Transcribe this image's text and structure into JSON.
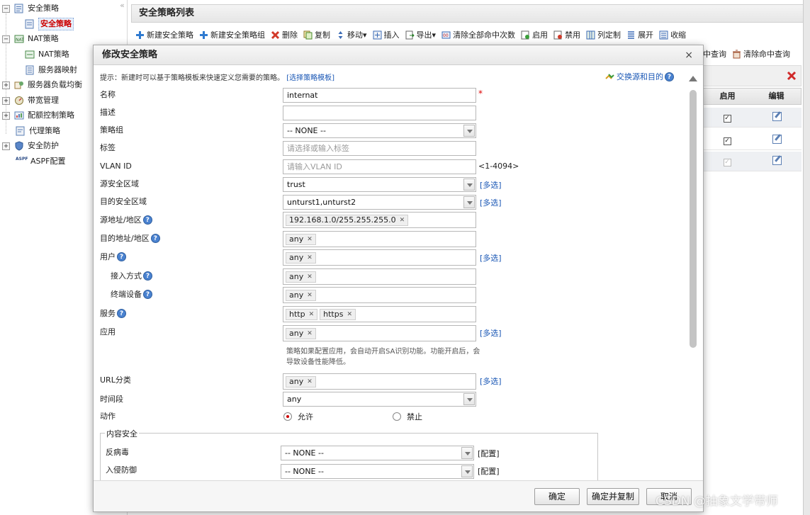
{
  "sidebar": {
    "collapse_glyph": "«",
    "items": [
      {
        "label": "安全策略",
        "toggle": "−",
        "icon": "policy-folder-icon"
      },
      {
        "label": "安全策略",
        "selected": true,
        "icon": "policy-icon"
      },
      {
        "label": "NAT策略",
        "toggle": "−",
        "icon": "nat-icon"
      },
      {
        "label": "NAT策略",
        "icon": "nat-policy-icon"
      },
      {
        "label": "服务器映射",
        "icon": "server-map-icon"
      },
      {
        "label": "服务器负载均衡",
        "toggle": "+",
        "icon": "load-balance-icon"
      },
      {
        "label": "带宽管理",
        "toggle": "+",
        "icon": "bandwidth-icon"
      },
      {
        "label": "配额控制策略",
        "toggle": "+",
        "icon": "quota-icon"
      },
      {
        "label": "代理策略",
        "icon": "proxy-icon"
      },
      {
        "label": "安全防护",
        "toggle": "+",
        "icon": "shield-icon"
      },
      {
        "label": "ASPF配置",
        "icon": "aspf-icon",
        "icon_text": "ASPF"
      }
    ]
  },
  "main": {
    "title": "安全策略列表",
    "toolbar": [
      {
        "label": "新建安全策略",
        "icon": "plus-icon"
      },
      {
        "label": "新建安全策略组",
        "icon": "plus-icon"
      },
      {
        "label": "删除",
        "icon": "delete-icon"
      },
      {
        "label": "复制",
        "icon": "copy-icon"
      },
      {
        "label": "移动▾",
        "icon": "move-icon"
      },
      {
        "label": "插入",
        "icon": "insert-icon"
      },
      {
        "label": "导出▾",
        "icon": "export-icon"
      },
      {
        "label": "清除全部命中次数",
        "icon": "clear-hits-icon"
      },
      {
        "label": "启用",
        "icon": "enable-icon"
      },
      {
        "label": "禁用",
        "icon": "disable-icon"
      },
      {
        "label": "列定制",
        "icon": "columns-icon"
      },
      {
        "label": "展开",
        "icon": "expand-icon"
      },
      {
        "label": "收缩",
        "icon": "collapse-icon"
      }
    ],
    "toolbar2": [
      {
        "label": "中查询"
      },
      {
        "label": "清除命中查询",
        "icon": "clear-query-icon"
      }
    ],
    "table": {
      "headers": [
        "启用",
        "编辑"
      ],
      "rows": [
        {
          "enabled": true,
          "disabled": false
        },
        {
          "enabled": true,
          "disabled": false
        },
        {
          "enabled": true,
          "disabled": true
        }
      ]
    }
  },
  "dialog": {
    "title": "修改安全策略",
    "close": "×",
    "hint_text": "提示：新建时可以基于策略模板来快速定义您需要的策略。",
    "hint_link": "[选择策略模板]",
    "swap_label": "交换源和目的",
    "fields": {
      "name": {
        "label": "名称",
        "value": "internat",
        "required": "*"
      },
      "desc": {
        "label": "描述",
        "value": ""
      },
      "group": {
        "label": "策略组",
        "value": "-- NONE --"
      },
      "tag": {
        "label": "标签",
        "placeholder": "请选择或输入标签"
      },
      "vlan": {
        "label": "VLAN ID",
        "placeholder": "请输入VLAN ID",
        "range": "<1-4094>"
      },
      "src_zone": {
        "label": "源安全区域",
        "value": "trust",
        "link": "[多选]"
      },
      "dst_zone": {
        "label": "目的安全区域",
        "value": "unturst1,unturst2",
        "link": "[多选]"
      },
      "src_addr": {
        "label": "源地址/地区",
        "tags": [
          "192.168.1.0/255.255.255.0"
        ]
      },
      "dst_addr": {
        "label": "目的地址/地区",
        "tags": [
          "any"
        ]
      },
      "user": {
        "label": "用户",
        "tags": [
          "any"
        ],
        "link": "[多选]"
      },
      "access": {
        "label": "接入方式",
        "tags": [
          "any"
        ]
      },
      "terminal": {
        "label": "终端设备",
        "tags": [
          "any"
        ]
      },
      "service": {
        "label": "服务",
        "tags": [
          "http",
          "https"
        ]
      },
      "app": {
        "label": "应用",
        "tags": [
          "any"
        ],
        "link": "[多选]"
      },
      "app_note": "策略如果配置应用，会自动开启SA识别功能。功能开启后，会导致设备性能降低。",
      "url": {
        "label": "URL分类",
        "tags": [
          "any"
        ],
        "link": "[多选]"
      },
      "time": {
        "label": "时间段",
        "value": "any"
      },
      "action": {
        "label": "动作",
        "allow": "允许",
        "deny": "禁止",
        "selected": "allow"
      }
    },
    "content_security": {
      "legend": "内容安全",
      "antivirus": {
        "label": "反病毒",
        "value": "-- NONE --",
        "link": "[配置]"
      },
      "ips": {
        "label": "入侵防御",
        "value": "-- NONE --",
        "link": "[配置]"
      }
    },
    "buttons": {
      "ok": "确定",
      "ok_copy": "确定并复制",
      "cancel": "取消"
    }
  },
  "watermark": "CSDN @抽象文学带师",
  "colors": {
    "link": "#1a57b5",
    "selected_text": "#cc0000",
    "required": "#dd0000"
  }
}
